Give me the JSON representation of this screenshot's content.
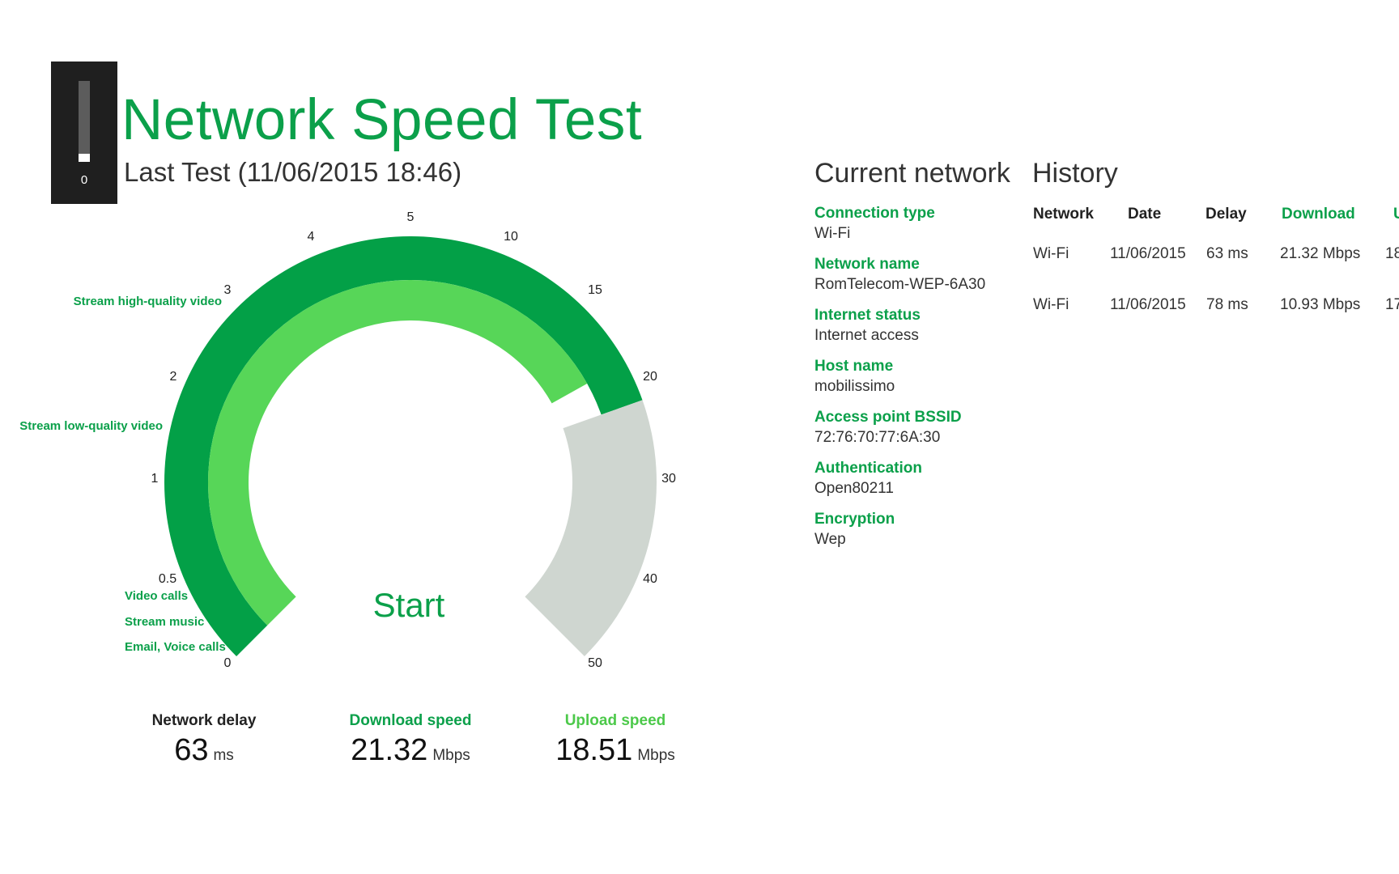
{
  "app": {
    "title": "Network Speed Test",
    "last_test": "Last Test (11/06/2015 18:46)",
    "signal_value": "0",
    "signal_level": 0.1
  },
  "colors": {
    "accent": "#0ba04a",
    "dark_green": "#03a047",
    "light_green": "#57d658",
    "gray": "#cfd6d0",
    "upload_green": "#4cc94a"
  },
  "gauge": {
    "ticks": [
      "0",
      "0.5",
      "1",
      "2",
      "3",
      "4",
      "5",
      "10",
      "15",
      "20",
      "30",
      "40",
      "50"
    ],
    "categories": [
      "Stream high-quality video",
      "Stream low-quality video",
      "Video calls",
      "Stream music",
      "Email, Voice calls"
    ],
    "start_label": "Start",
    "download_value": 21.32,
    "upload_value": 18.51
  },
  "metrics": {
    "delay": {
      "label": "Network delay",
      "value": "63",
      "unit": "ms"
    },
    "download": {
      "label": "Download speed",
      "value": "21.32",
      "unit": "Mbps"
    },
    "upload": {
      "label": "Upload speed",
      "value": "18.51",
      "unit": "Mbps"
    }
  },
  "current_network": {
    "heading": "Current network",
    "items": [
      {
        "label": "Connection type",
        "value": "Wi-Fi"
      },
      {
        "label": "Network name",
        "value": "RomTelecom-WEP-6A30"
      },
      {
        "label": "Internet status",
        "value": "Internet access"
      },
      {
        "label": "Host name",
        "value": "mobilissimo"
      },
      {
        "label": "Access point BSSID",
        "value": "72:76:70:77:6A:30"
      },
      {
        "label": "Authentication",
        "value": "Open80211"
      },
      {
        "label": "Encryption",
        "value": "Wep"
      }
    ]
  },
  "history": {
    "heading": "History",
    "columns": [
      "Network",
      "Date",
      "Delay",
      "Download",
      "U"
    ],
    "rows": [
      [
        "Wi-Fi",
        "11/06/2015",
        "63 ms",
        "21.32 Mbps",
        "18"
      ],
      [
        "Wi-Fi",
        "11/06/2015",
        "78 ms",
        "10.93 Mbps",
        "17"
      ]
    ]
  }
}
